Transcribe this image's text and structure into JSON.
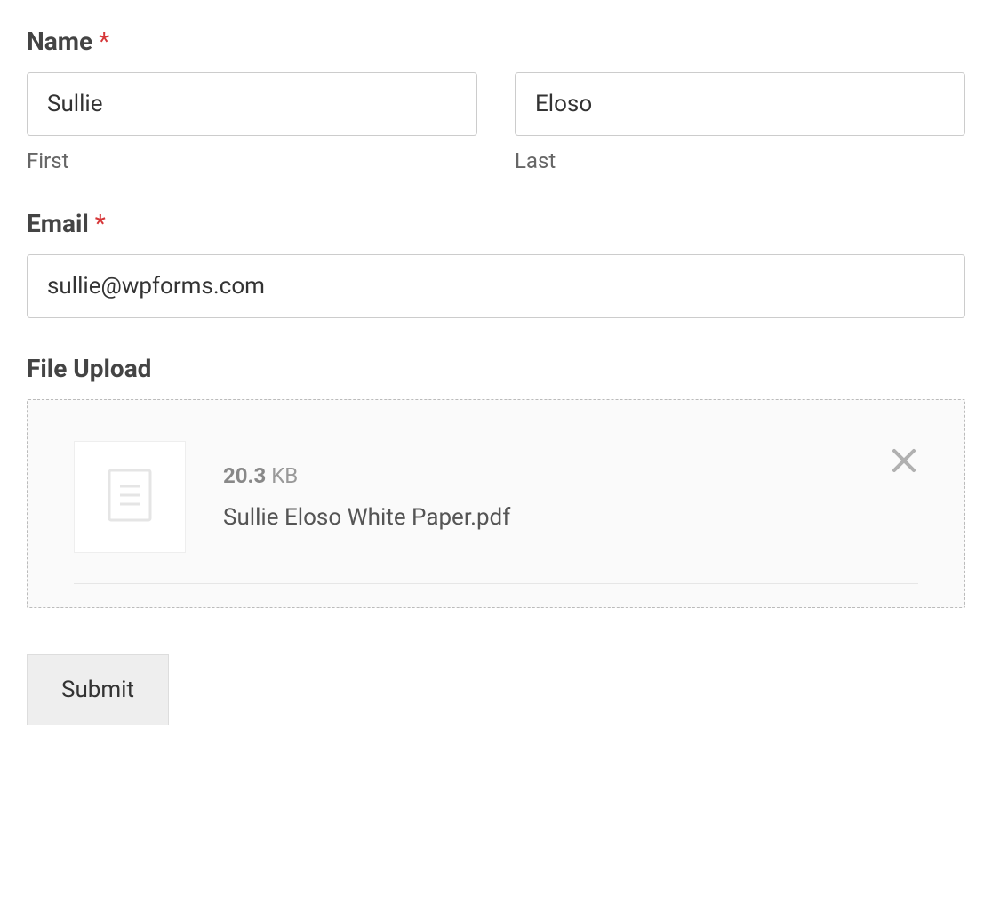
{
  "fields": {
    "name": {
      "label": "Name",
      "required": true,
      "required_indicator": "*",
      "first": {
        "value": "Sullie",
        "sublabel": "First"
      },
      "last": {
        "value": "Eloso",
        "sublabel": "Last"
      }
    },
    "email": {
      "label": "Email",
      "required": true,
      "required_indicator": "*",
      "value": "sullie@wpforms.com"
    },
    "file_upload": {
      "label": "File Upload",
      "file": {
        "size_value": "20.3",
        "size_unit": "KB",
        "name": "Sullie Eloso White Paper.pdf"
      }
    }
  },
  "submit": {
    "label": "Submit"
  }
}
